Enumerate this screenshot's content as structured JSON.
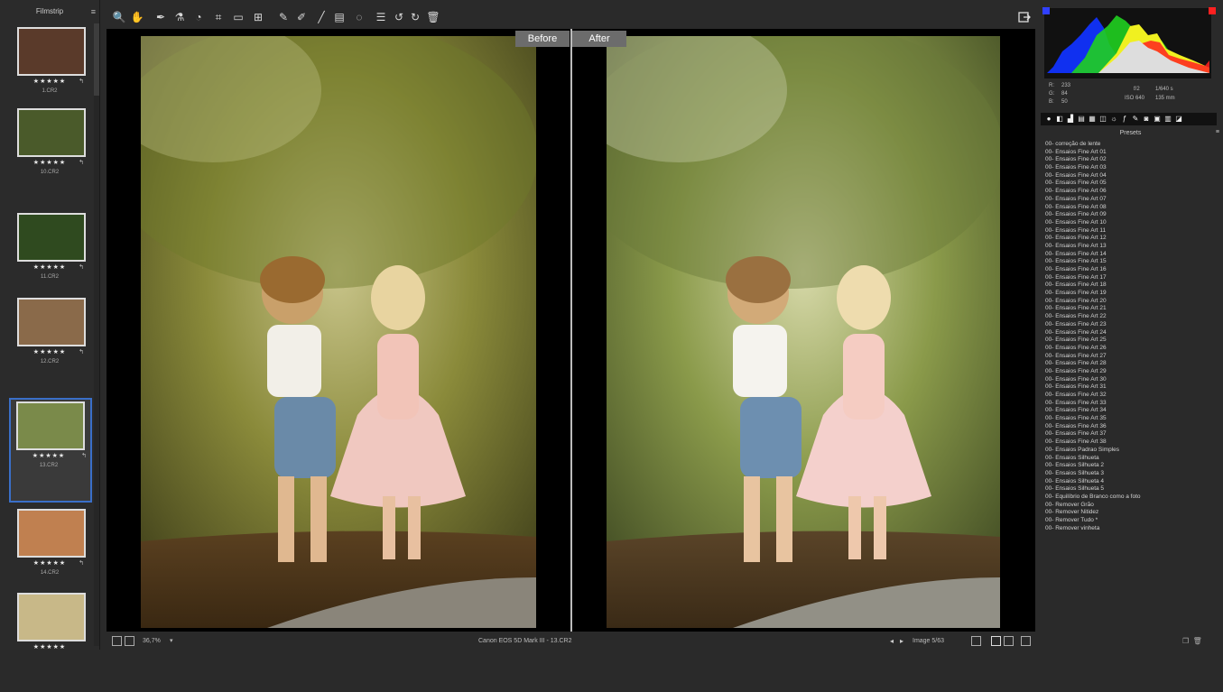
{
  "filmstrip": {
    "title": "Filmstrip",
    "menu_icon": "≡",
    "items": [
      {
        "name": "1.CR2",
        "stars": "★★★★★",
        "flag": "↰",
        "color": "#5a3a2a"
      },
      {
        "name": "10.CR2",
        "stars": "★★★★★",
        "flag": "↰",
        "color": "#4a5a2a"
      },
      {
        "name": "11.CR2",
        "stars": "★★★★★",
        "flag": "↰",
        "color": "#2f4a1f"
      },
      {
        "name": "12.CR2",
        "stars": "★★★★★",
        "flag": "↰",
        "color": "#8a6a4a"
      },
      {
        "name": "13.CR2",
        "stars": "★★★★★",
        "flag": "↰",
        "color": "#7a8a4a"
      },
      {
        "name": "14.CR2",
        "stars": "★★★★★",
        "flag": "↰",
        "color": "#c08050"
      },
      {
        "name": "",
        "stars": "★★★★★",
        "flag": "",
        "color": "#c8b888"
      }
    ]
  },
  "toolbar": {
    "tools": [
      "zoom-icon",
      "hand-icon",
      "eyedropper-icon",
      "color-picker-icon",
      "white-balance-icon",
      "crop-icon",
      "straighten-icon",
      "transform-icon",
      "heal-icon",
      "spot-removal-icon",
      "brush-icon",
      "note-icon",
      "mask-icon",
      "list-icon",
      "rotate-left-icon",
      "rotate-right-icon",
      "trash-icon"
    ],
    "export_icon": "export-icon"
  },
  "viewer": {
    "before_label": "Before",
    "after_label": "After"
  },
  "bottombar": {
    "zoom": "36,7%",
    "zoom_arrow": "▾",
    "camera_info": "Canon EOS 5D Mark III  -  13.CR2",
    "image_number": "Image 5/63",
    "prev": "◂",
    "next": "▸"
  },
  "histogram": {
    "r_label": "R:",
    "r_value": "233",
    "g_label": "G:",
    "g_value": "84",
    "b_label": "B:",
    "b_value": "50",
    "aperture": "f/2",
    "shutter": "1/640 s",
    "iso": "ISO 640",
    "focal": "135 mm"
  },
  "panel_tabs": [
    "●",
    "◧",
    "▟",
    "▤",
    "▦",
    "◫",
    "☼",
    "ƒ",
    "✎",
    "◙",
    "▣",
    "▥",
    "◪"
  ],
  "presets": {
    "title": "Presets",
    "menu_icon": "≡",
    "items": [
      "00- correção de lente",
      "00- Ensaios Fine Art 01",
      "00- Ensaios Fine Art 02",
      "00- Ensaios Fine Art 03",
      "00- Ensaios Fine Art 04",
      "00- Ensaios Fine Art 05",
      "00- Ensaios Fine Art 06",
      "00- Ensaios Fine Art 07",
      "00- Ensaios Fine Art 08",
      "00- Ensaios Fine Art 09",
      "00- Ensaios Fine Art 10",
      "00- Ensaios Fine Art 11",
      "00- Ensaios Fine Art 12",
      "00- Ensaios Fine Art 13",
      "00- Ensaios Fine Art 14",
      "00- Ensaios Fine Art 15",
      "00- Ensaios Fine Art 16",
      "00- Ensaios Fine Art 17",
      "00- Ensaios Fine Art 18",
      "00- Ensaios Fine Art 19",
      "00- Ensaios Fine Art 20",
      "00- Ensaios Fine Art 21",
      "00- Ensaios Fine Art 22",
      "00- Ensaios Fine Art 23",
      "00- Ensaios Fine Art 24",
      "00- Ensaios Fine Art 25",
      "00- Ensaios Fine Art 26",
      "00- Ensaios Fine Art 27",
      "00- Ensaios Fine Art 28",
      "00- Ensaios Fine Art 29",
      "00- Ensaios Fine Art 30",
      "00- Ensaios Fine Art 31",
      "00- Ensaios Fine Art 32",
      "00- Ensaios Fine Art 33",
      "00- Ensaios Fine Art 34",
      "00- Ensaios Fine Art 35",
      "00- Ensaios Fine Art 36",
      "00- Ensaios Fine Art 37",
      "00- Ensaios Fine Art 38",
      "00- Ensaios Padrao Simples",
      "00- Ensaios Silhueta",
      "00- Ensaios Silhueta 2",
      "00- Ensaios Silhueta 3",
      "00- Ensaios Silhueta 4",
      "00- Ensaios Silhueta 5",
      "00- Equilíbrio de Branco como a foto",
      "00- Remover Grão",
      "00- Remover Nitidez",
      "00- Remover Tudo *",
      "00- Remover vinheta"
    ]
  },
  "colors": {
    "accent_selected": "#3a6fc8",
    "panel_bg": "#2a2a2a",
    "viewer_bg": "#000000"
  }
}
